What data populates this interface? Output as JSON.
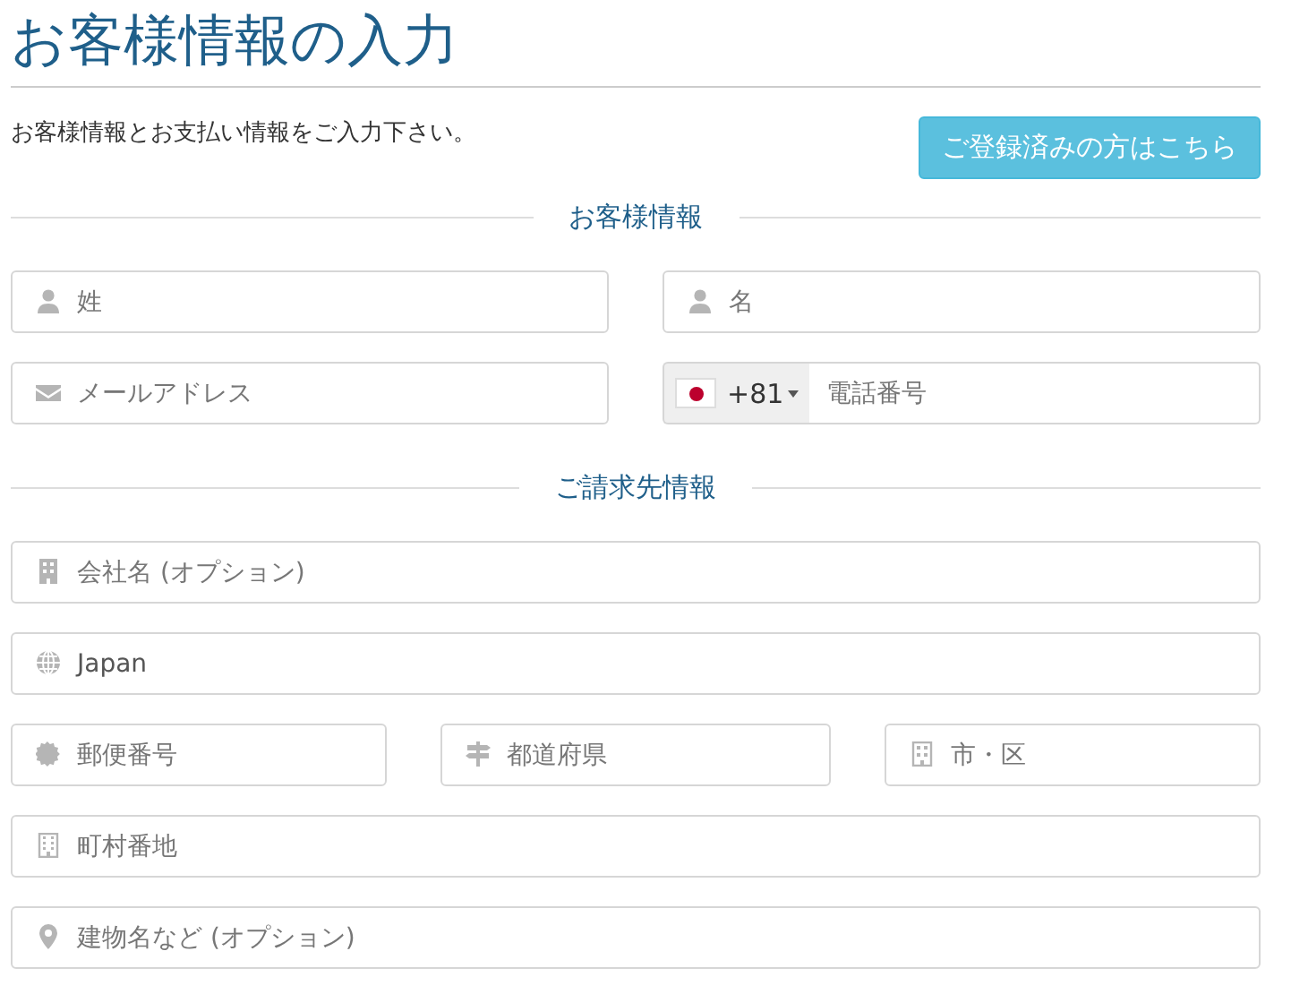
{
  "title": "お客様情報の入力",
  "intro": "お客様情報とお支払い情報をご入力下さい。",
  "login_button": "ご登録済みの方はこちら",
  "sections": [
    {
      "heading": "お客様情報",
      "rows": [
        [
          {
            "kind": "text",
            "placeholder": "姓"
          },
          {
            "kind": "text",
            "placeholder": "名"
          }
        ],
        [
          {
            "kind": "text",
            "placeholder": "メールアドレス"
          },
          {
            "kind": "phone",
            "country_code": "+81",
            "placeholder": "電話番号"
          }
        ]
      ]
    },
    {
      "heading": "ご請求先情報",
      "rows": [
        [
          {
            "kind": "text",
            "placeholder": "会社名 (オプション)"
          }
        ],
        [
          {
            "kind": "text",
            "value": "Japan"
          }
        ],
        [
          {
            "kind": "text",
            "placeholder": "郵便番号"
          },
          {
            "kind": "text",
            "placeholder": "都道府県"
          },
          {
            "kind": "text",
            "placeholder": "市・区"
          }
        ],
        [
          {
            "kind": "text",
            "placeholder": "町村番地"
          }
        ],
        [
          {
            "kind": "text",
            "placeholder": "建物名など (オプション)"
          }
        ]
      ]
    }
  ]
}
